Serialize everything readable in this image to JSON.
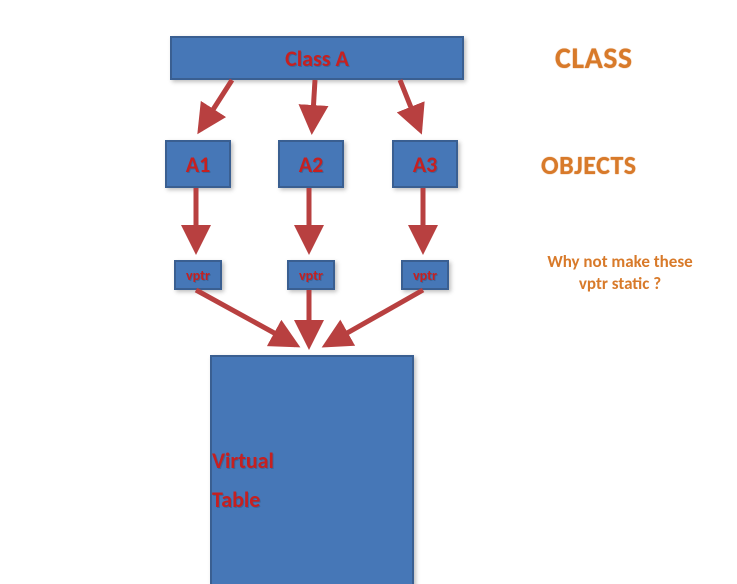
{
  "classBox": {
    "label": "Class A"
  },
  "objects": {
    "a1": {
      "label": "A1"
    },
    "a2": {
      "label": "A2"
    },
    "a3": {
      "label": "A3"
    }
  },
  "vptrs": {
    "v1": {
      "label": "vptr"
    },
    "v2": {
      "label": "vptr"
    },
    "v3": {
      "label": "vptr"
    }
  },
  "vtable": {
    "line1": "Virtual",
    "line2": "Table"
  },
  "sideLabels": {
    "class": "CLASS",
    "objects": "OBJECTS",
    "note": "Why not make these vptr static ?"
  }
}
